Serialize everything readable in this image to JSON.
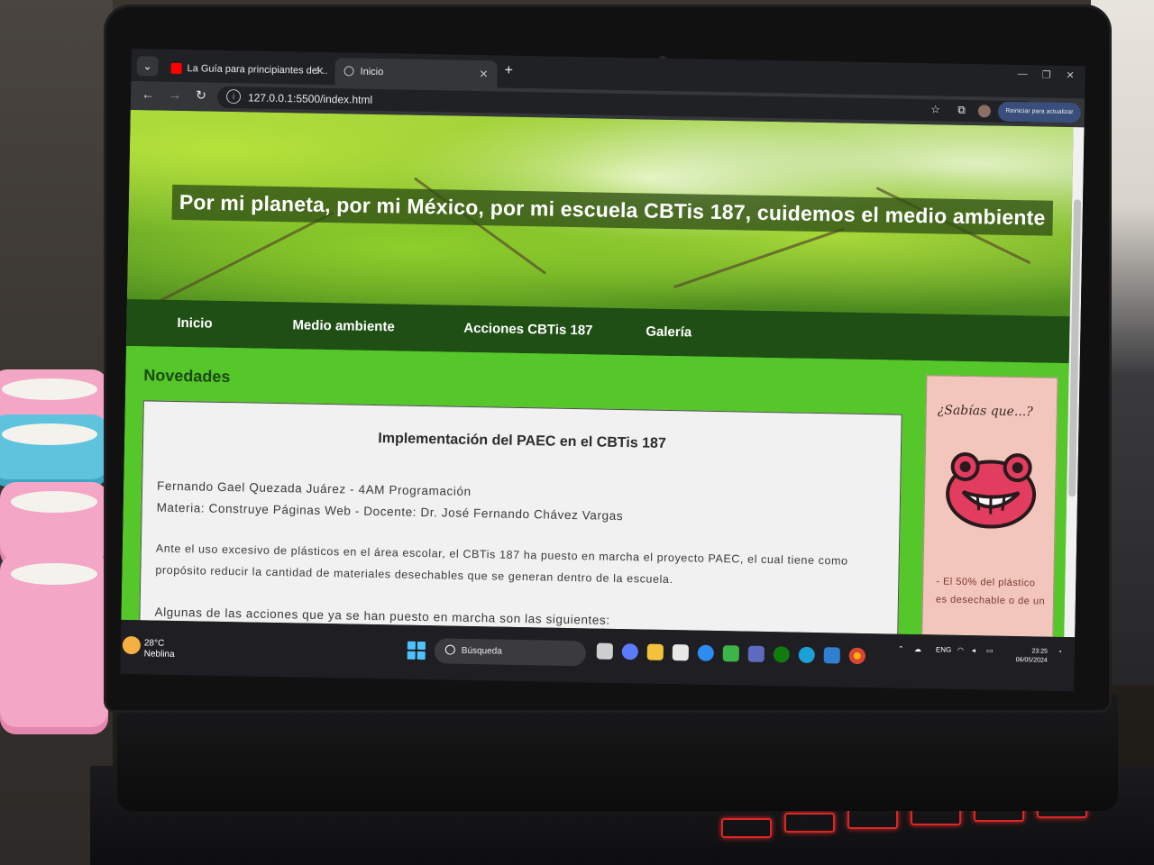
{
  "browser": {
    "tabs": [
      {
        "label": "La Guía para principiantes del ..",
        "active": false
      },
      {
        "label": "Inicio",
        "active": true
      }
    ],
    "new_tab": "+",
    "url": "127.0.0.1:5500/index.html",
    "relaunch_label": "Reiniciar para actualizar"
  },
  "site": {
    "banner_title": "Por mi planeta, por mi México, por mi escuela CBTis 187, cuidemos el medio ambiente",
    "nav": [
      "Inicio",
      "Medio ambiente",
      "Acciones CBTis 187",
      "Galería"
    ],
    "section_title": "Novedades",
    "card": {
      "title": "Implementación del PAEC en el CBTis 187",
      "author": "Fernando Gael Quezada Juárez - 4AM Programación",
      "subject": "Materia: Construye Páginas Web - Docente: Dr. José Fernando Chávez Vargas",
      "para1_line1": "Ante el uso excesivo de plásticos en el área escolar, el CBTis 187 ha puesto en marcha el proyecto PAEC, el cual tiene como",
      "para1_line2": "propósito reducir la cantidad de materiales desechables que se generan dentro de la escuela.",
      "para2": "Algunas de las acciones que ya se han puesto en marcha son las siguientes:"
    },
    "aside": {
      "title": "¿Sabías que...?",
      "text_line1": "- El 50% del plástico",
      "text_line2": "es desechable o de un"
    }
  },
  "taskbar": {
    "weather_temp": "28°C",
    "weather_desc": "Neblina",
    "search_label": "Búsqueda",
    "lang": "ENG",
    "time": "23:25",
    "date": "06/05/2024"
  },
  "colors": {
    "page_green": "#55c72a",
    "nav_dark_green": "#1f4f15",
    "aside_pink": "#f2c6bd",
    "keyboard_backlight": "#ff2a2a"
  }
}
